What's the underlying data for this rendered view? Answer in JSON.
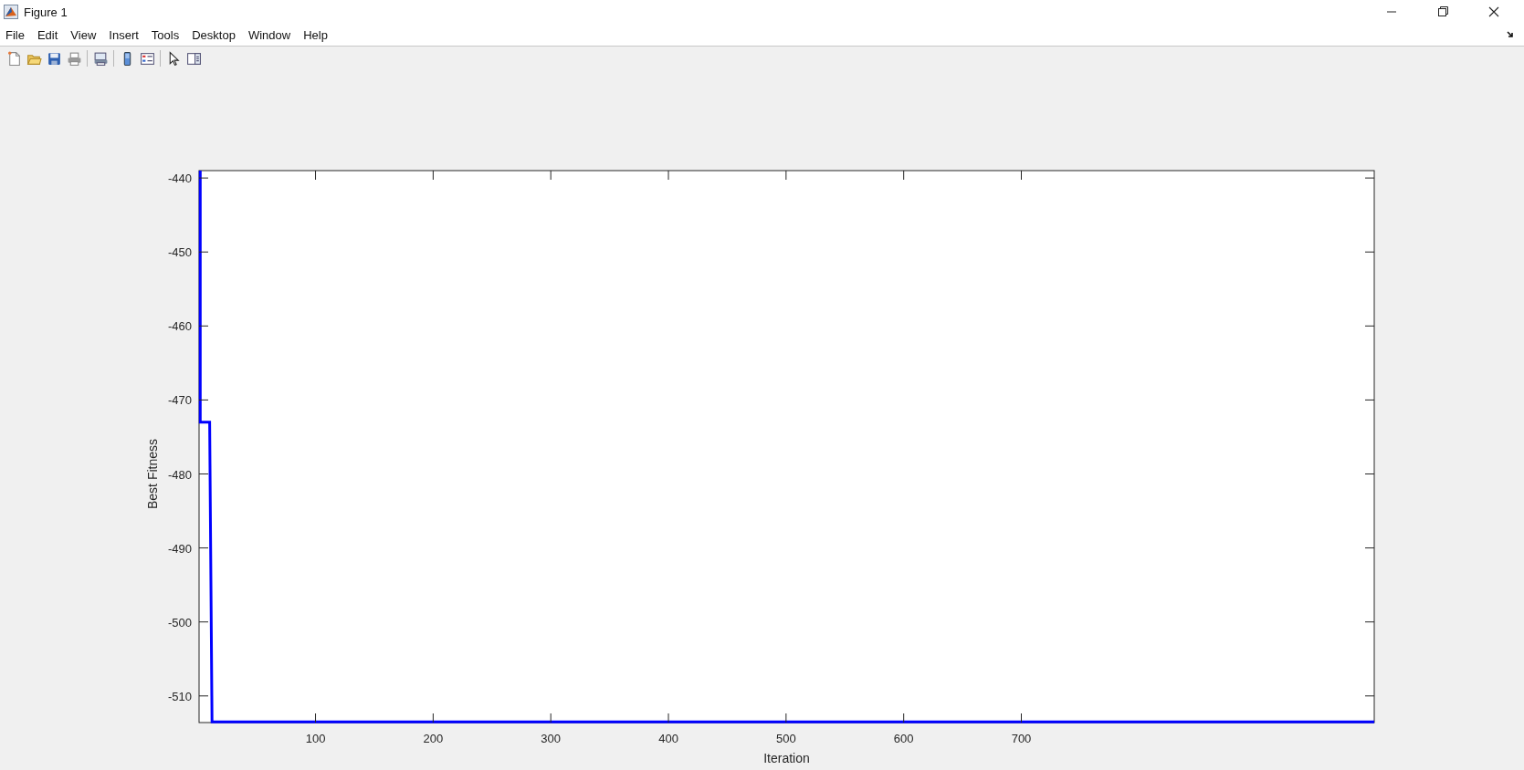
{
  "window": {
    "title": "Figure 1"
  },
  "menu": [
    "File",
    "Edit",
    "View",
    "Insert",
    "Tools",
    "Desktop",
    "Window",
    "Help"
  ],
  "toolbar": [
    {
      "kind": "new"
    },
    {
      "kind": "open"
    },
    {
      "kind": "save"
    },
    {
      "kind": "print"
    },
    {
      "kind": "sep"
    },
    {
      "kind": "link"
    },
    {
      "kind": "sep"
    },
    {
      "kind": "colorbar"
    },
    {
      "kind": "legend"
    },
    {
      "kind": "sep"
    },
    {
      "kind": "pointer"
    },
    {
      "kind": "panel"
    }
  ],
  "chart": {
    "chart_data": {
      "type": "line",
      "xlabel": "Iteration",
      "ylabel": "Best Fitness",
      "xlim": [
        1,
        1000
      ],
      "ylim": [
        -513.6,
        -439
      ],
      "xticks": [
        100,
        200,
        300,
        400,
        500,
        600,
        700
      ],
      "yticks": [
        -510,
        -500,
        -490,
        -480,
        -470,
        -460,
        -450,
        -440
      ],
      "series": [
        {
          "color": "#0000ff",
          "values": [
            -439,
            -473,
            -473,
            -513.5,
            -513.5
          ]
        }
      ],
      "x": [
        2,
        2,
        10,
        12,
        1000
      ]
    }
  }
}
